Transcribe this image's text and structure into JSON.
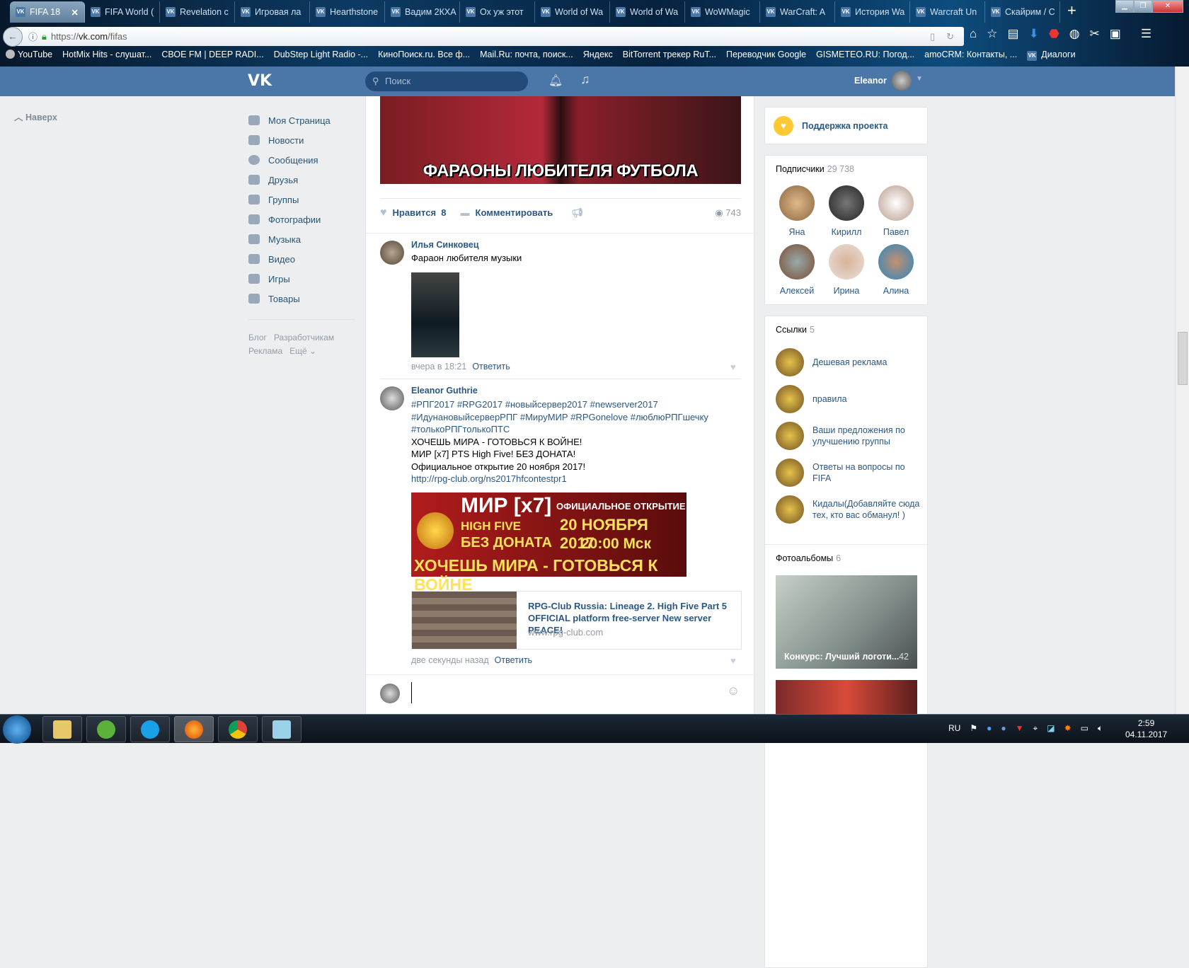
{
  "browser": {
    "tabs": [
      "FIFA 18",
      "FIFA World (",
      "Revelation с",
      "Игровая ла",
      "Hearthstone",
      "Вадим 2КХА",
      "Ох уж этот",
      "World of Wa",
      "World of Wa",
      "WoWMagic",
      "WarCraft: A",
      "История Wa",
      "Warcraft Un",
      "Скайрим / С"
    ],
    "url_prefix": "https://",
    "url_host": "vk.com",
    "url_path": "/fifas",
    "bookmarks": [
      "YouTube",
      "HotMix Hits - слушат...",
      "СВОЕ FM | DEEP RADI...",
      "DubStep Light Radio -...",
      "КиноПоиск.ru. Все ф...",
      "Mail.Ru: почта, поиск...",
      "Яндекс",
      "BitTorrent трекер RuT...",
      "Переводчик Google",
      "GISMETEO.RU: Погод...",
      "amoCRM: Контакты, ...",
      "Диалоги"
    ]
  },
  "vk": {
    "logo": "VK",
    "search_placeholder": "Поиск",
    "user_name": "Eleanor",
    "up_label": "Наверх",
    "nav": [
      "Моя Страница",
      "Новости",
      "Сообщения",
      "Друзья",
      "Группы",
      "Фотографии",
      "Музыка",
      "Видео",
      "Игры",
      "Товары"
    ],
    "footer": [
      "Блог",
      "Разработчикам",
      "Реклама",
      "Ещё ⌄"
    ]
  },
  "feed": {
    "top_image_caption": "ФАРАОНЫ ЛЮБИТЕЛЯ ФУТБОЛА",
    "like_label": "Нравится",
    "like_count": "8",
    "comment_label": "Комментировать",
    "views": "743",
    "comments": [
      {
        "author": "Илья Синковец",
        "text": "Фараон любителя музыки",
        "time": "вчера в 18:21",
        "reply": "Ответить"
      },
      {
        "author": "Eleanor Guthrie",
        "hashtags1": "#РПГ2017 #RPG2017 #новыйсервер2017 #newserver2017",
        "hashtags2": "#ИдунановыйсерверРПГ #МируМИР #RPGonelove #люблюРПГшечку",
        "hashtags3": "#толькоРПГтолькоПТС",
        "line1": "ХОЧЕШЬ МИРА - ГОТОВЬСЯ К ВОЙНЕ!",
        "line2": "МИР [x7] PTS High Five! БЕЗ ДОНАТА!",
        "line3": "Официальное открытие 20 ноября 2017!",
        "link": "http://rpg-club.org/ns2017hfcontestpr1",
        "banner": {
          "t1": "МИР [x7]",
          "t2": "ОФИЦИАЛЬНОЕ ОТКРЫТИЕ",
          "t3": "HIGH FIVE",
          "t4": "20 НОЯБРЯ 2017",
          "t5": "БЕЗ ДОНАТА",
          "t6": "20:00 Мск",
          "t7": "ХОЧЕШЬ МИРА - ГОТОВЬСЯ К ВОЙНЕ"
        },
        "snippet_title": "RPG-Club Russia: Lineage 2. High Five Part 5 OFFICIAL platform free-server New server PEACE!",
        "snippet_url": "www.rpg-club.com",
        "time": "две секунды назад",
        "reply": "Ответить"
      }
    ]
  },
  "right": {
    "support": "Поддержка проекта",
    "subscribers_title": "Подписчики",
    "subscribers_count": "29 738",
    "subscribers": [
      "Яна",
      "Кирилл",
      "Павел",
      "Алексей",
      "Ирина",
      "Алина"
    ],
    "links_title": "Ссылки",
    "links_count": "5",
    "links": [
      "Дешевая реклама",
      "правила",
      "Ваши предложения по улучшению группы",
      "Ответы на вопросы по FIFA",
      "Кидалы(Добавляйте сюда тех, кто вас обманул! )"
    ],
    "albums_title": "Фотоальбомы",
    "albums_count": "6",
    "album_caption": "Конкурс: Лучший логоти...",
    "album_count": "42"
  },
  "taskbar": {
    "lang": "RU",
    "time": "2:59",
    "date": "04.11.2017"
  }
}
